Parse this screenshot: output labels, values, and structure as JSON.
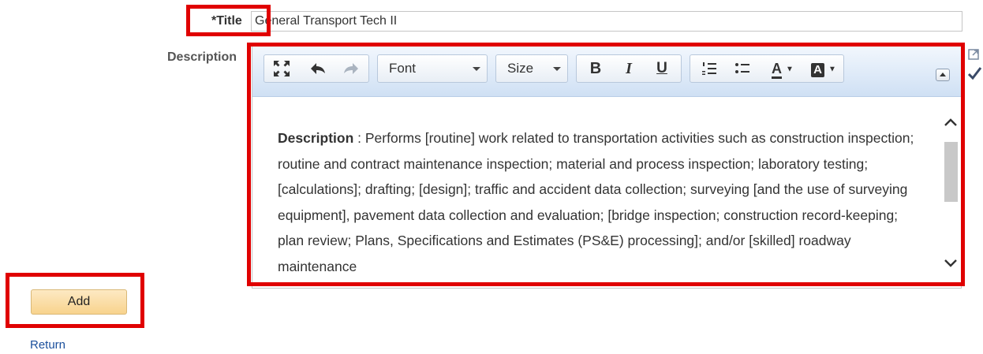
{
  "form": {
    "title_label": "*Title",
    "title_value": "General Transport Tech II",
    "description_label": "Description"
  },
  "editor": {
    "toolbar": {
      "font_label": "Font",
      "size_label": "Size",
      "bold": "B",
      "italic": "I",
      "underline": "U",
      "text_color": "A",
      "bg_color": "A"
    },
    "content": {
      "keyword": "Description",
      "text": " : Performs [routine] work related to transportation activities such as construction inspection; routine and contract maintenance inspection; material and process inspection; laboratory testing; [calculations]; drafting; [design]; traffic and accident data collection; surveying [and the use of surveying equipment], pavement data collection and evaluation; [bridge inspection; construction record-keeping; plan review; Plans, Specifications and Estimates (PS&E) processing]; and/or [skilled] roadway maintenance"
    }
  },
  "actions": {
    "add_label": "Add",
    "return_label": "Return"
  },
  "colors": {
    "highlight": "#e00000",
    "link": "#1a4f9c",
    "button_bg": "#f8d38d"
  }
}
